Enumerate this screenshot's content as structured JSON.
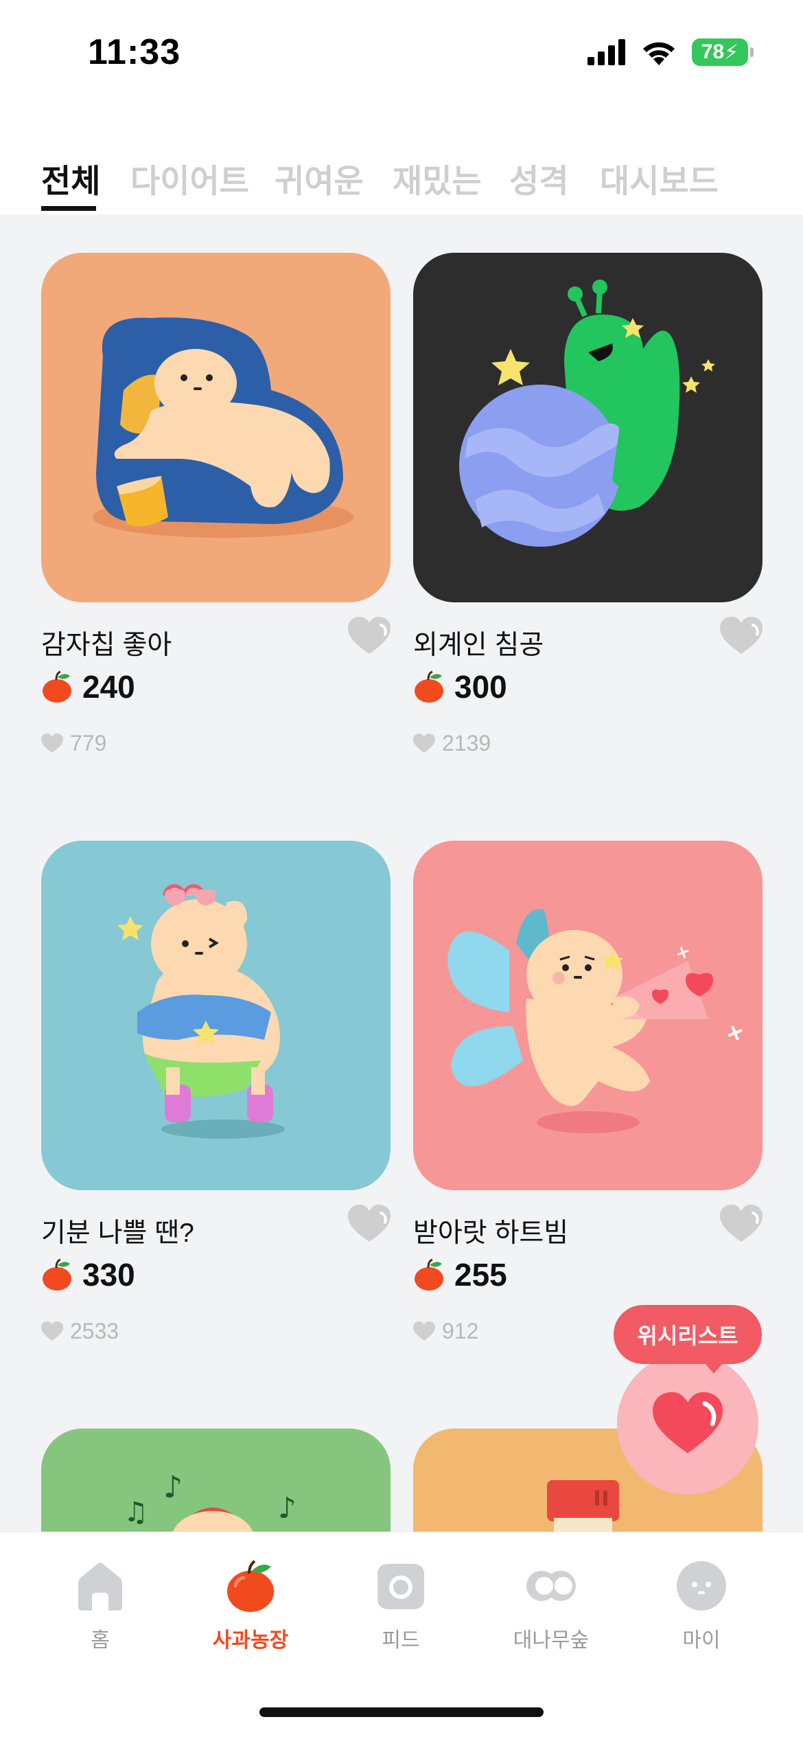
{
  "status": {
    "time": "11:33",
    "battery": "78"
  },
  "tabs": [
    {
      "label": "전체"
    },
    {
      "label": "다이어트"
    },
    {
      "label": "귀여운"
    },
    {
      "label": "재밌는"
    },
    {
      "label": "성격"
    },
    {
      "label": "대시보드"
    }
  ],
  "items": [
    {
      "title": "감자칩 좋아",
      "price": "240",
      "likes": "779",
      "bg": "#f2a97a"
    },
    {
      "title": "외계인 침공",
      "price": "300",
      "likes": "2139",
      "bg": "#2d2d2d"
    },
    {
      "title": "기분 나쁠 땐?",
      "price": "330",
      "likes": "2533",
      "bg": "#86c8d3"
    },
    {
      "title": "받아랏 하트빔",
      "price": "255",
      "likes": "912",
      "bg": "#f79696"
    },
    {
      "bg": "#86c57d"
    },
    {
      "bg": "#f2b870"
    }
  ],
  "wishlist": {
    "label": "위시리스트"
  },
  "nav": [
    {
      "label": "홈"
    },
    {
      "label": "사과농장"
    },
    {
      "label": "피드"
    },
    {
      "label": "대나무숲"
    },
    {
      "label": "마이"
    }
  ],
  "colors": {
    "accent": "#f04a1e",
    "wishlist": "#f25a64"
  }
}
